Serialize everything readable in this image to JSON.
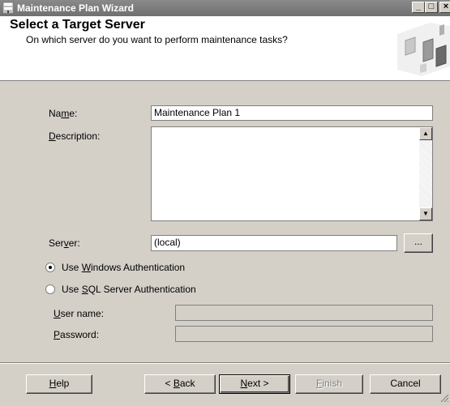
{
  "window": {
    "title": "Maintenance Plan Wizard",
    "minimize_glyph": "_",
    "maximize_glyph": "□",
    "close_glyph": "×"
  },
  "header": {
    "title": "Select a Target Server",
    "subtitle": "On which server do you want to perform maintenance tasks?"
  },
  "form": {
    "name_label_pre": "Na",
    "name_label_key": "m",
    "name_label_post": "e:",
    "name_value": "Maintenance Plan 1",
    "description_label_key": "D",
    "description_label_post": "escription:",
    "description_value": "",
    "server_label_pre": "Ser",
    "server_label_key": "v",
    "server_label_post": "er:",
    "server_value": "(local)",
    "browse_label": "...",
    "auth_windows_pre": "Use ",
    "auth_windows_key": "W",
    "auth_windows_post": "indows Authentication",
    "auth_sql_pre": "Use ",
    "auth_sql_key": "S",
    "auth_sql_post": "QL Server Authentication",
    "selected_auth": "windows",
    "username_label_key": "U",
    "username_label_post": "ser name:",
    "username_value": "",
    "password_label_key": "P",
    "password_label_post": "assword:",
    "password_value": ""
  },
  "buttons": {
    "help_key": "H",
    "help_post": "elp",
    "back_pre": "< ",
    "back_key": "B",
    "back_post": "ack",
    "next_key": "N",
    "next_post": "ext >",
    "finish_key": "F",
    "finish_post": "inish",
    "cancel": "Cancel"
  },
  "colors": {
    "titlebar": "#7a7a7a",
    "dialog_bg": "#d4d0c8",
    "header_bg": "#ffffff"
  },
  "icons": {
    "app": "wizard-app-icon",
    "header_graphic": "server-wizard-graphic",
    "scroll_up": "scroll-up-icon",
    "scroll_down": "scroll-down-icon",
    "size_grip": "resize-grip-icon"
  }
}
